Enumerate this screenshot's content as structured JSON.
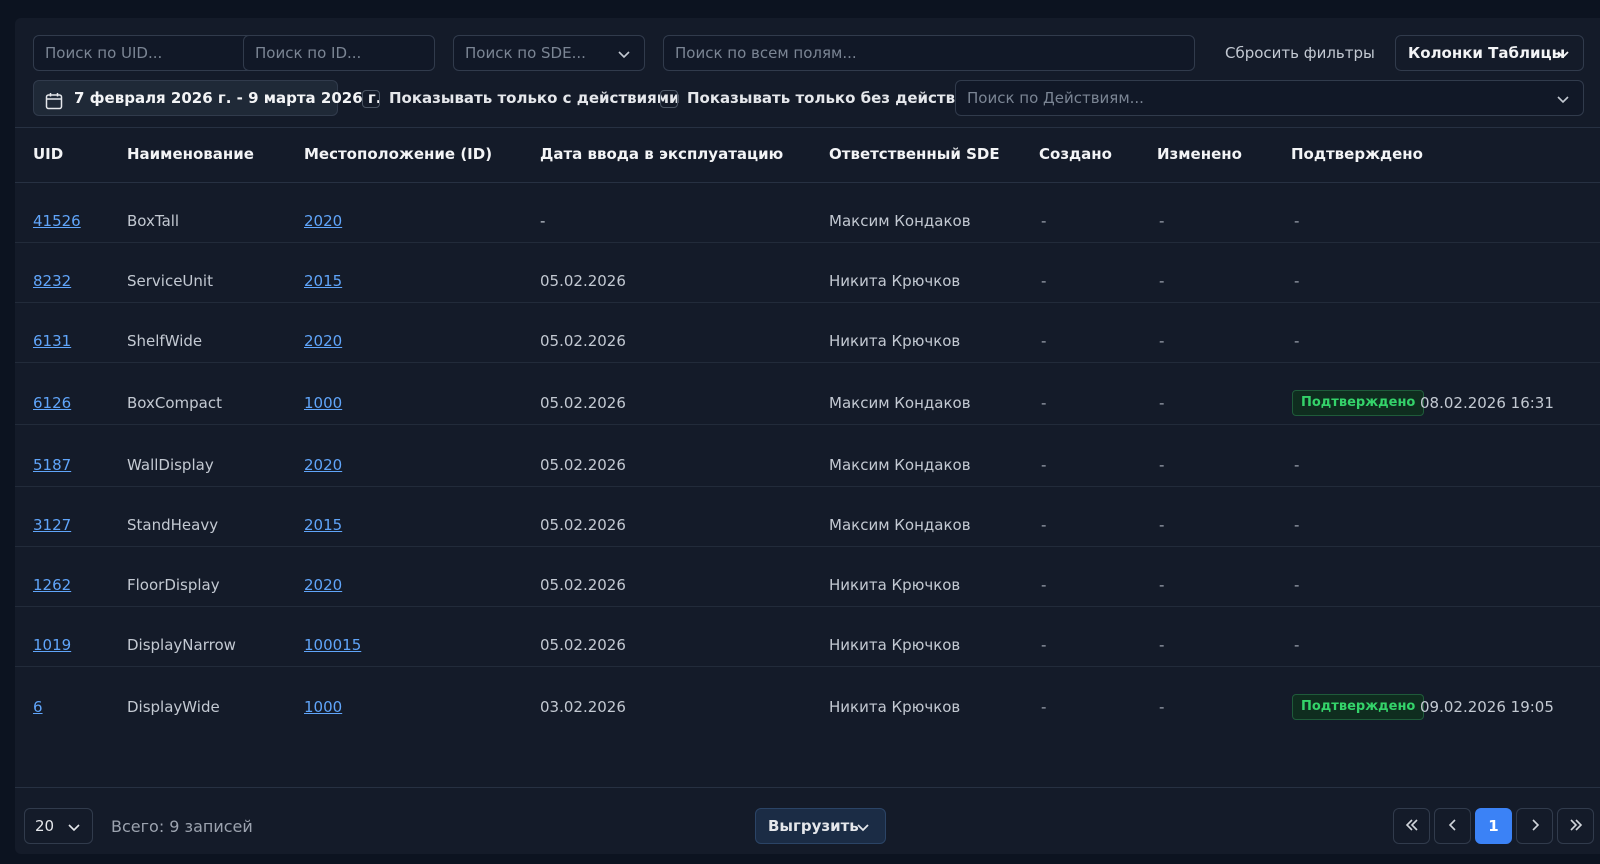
{
  "filters": {
    "uid_placeholder": "Поиск по UID...",
    "id_placeholder": "Поиск по ID...",
    "sde_placeholder": "Поиск по SDE...",
    "all_placeholder": "Поиск по всем полям...",
    "reset_label": "Сбросить фильтры",
    "columns_label": "Колонки Таблицы",
    "date_range": "7 февраля 2026 г. - 9 марта 2026 г.",
    "with_actions_label": "Показывать только с действиями",
    "without_actions_label": "Показывать только без действий",
    "actions_placeholder": "Поиск по Действиям..."
  },
  "table": {
    "headers": {
      "uid": "UID",
      "name": "Наименование",
      "location": "Местоположение (ID)",
      "date": "Дата ввода в эксплуатацию",
      "sde": "Ответственный SDE",
      "created": "Создано",
      "modified": "Изменено",
      "confirmed": "Подтверждено"
    },
    "rows": [
      {
        "uid": "41526",
        "name": "BoxTall",
        "location": "2020",
        "date": "-",
        "sde": "Максим Кондаков",
        "created": "-",
        "modified": "-",
        "confirmed": "-",
        "badge": "",
        "confirmed_at": ""
      },
      {
        "uid": "8232",
        "name": "ServiceUnit",
        "location": "2015",
        "date": "05.02.2026",
        "sde": "Никита Крючков",
        "created": "-",
        "modified": "-",
        "confirmed": "-",
        "badge": "",
        "confirmed_at": ""
      },
      {
        "uid": "6131",
        "name": "ShelfWide",
        "location": "2020",
        "date": "05.02.2026",
        "sde": "Никита Крючков",
        "created": "-",
        "modified": "-",
        "confirmed": "-",
        "badge": "",
        "confirmed_at": ""
      },
      {
        "uid": "6126",
        "name": "BoxCompact",
        "location": "1000",
        "date": "05.02.2026",
        "sde": "Максим Кондаков",
        "created": "-",
        "modified": "-",
        "confirmed": "",
        "badge": "Подтверждено",
        "confirmed_at": "08.02.2026 16:31"
      },
      {
        "uid": "5187",
        "name": "WallDisplay",
        "location": "2020",
        "date": "05.02.2026",
        "sde": "Максим Кондаков",
        "created": "-",
        "modified": "-",
        "confirmed": "-",
        "badge": "",
        "confirmed_at": ""
      },
      {
        "uid": "3127",
        "name": "StandHeavy",
        "location": "2015",
        "date": "05.02.2026",
        "sde": "Максим Кондаков",
        "created": "-",
        "modified": "-",
        "confirmed": "-",
        "badge": "",
        "confirmed_at": ""
      },
      {
        "uid": "1262",
        "name": "FloorDisplay",
        "location": "2020",
        "date": "05.02.2026",
        "sde": "Никита Крючков",
        "created": "-",
        "modified": "-",
        "confirmed": "-",
        "badge": "",
        "confirmed_at": ""
      },
      {
        "uid": "1019",
        "name": "DisplayNarrow",
        "location": "100015",
        "date": "05.02.2026",
        "sde": "Никита Крючков",
        "created": "-",
        "modified": "-",
        "confirmed": "-",
        "badge": "",
        "confirmed_at": ""
      },
      {
        "uid": "6",
        "name": "DisplayWide",
        "location": "1000",
        "date": "03.02.2026",
        "sde": "Никита Крючков",
        "created": "-",
        "modified": "-",
        "confirmed": "",
        "badge": "Подтверждено",
        "confirmed_at": "09.02.2026 19:05"
      }
    ]
  },
  "footer": {
    "page_size": "20",
    "total": "Всего: 9 записей",
    "export_label": "Выгрузить",
    "current_page": "1"
  },
  "colors": {
    "background": "#0c1320",
    "panel": "#141b29",
    "link": "#60a5fa",
    "badge_green": "#34d36a",
    "accent": "#3b82f6"
  }
}
